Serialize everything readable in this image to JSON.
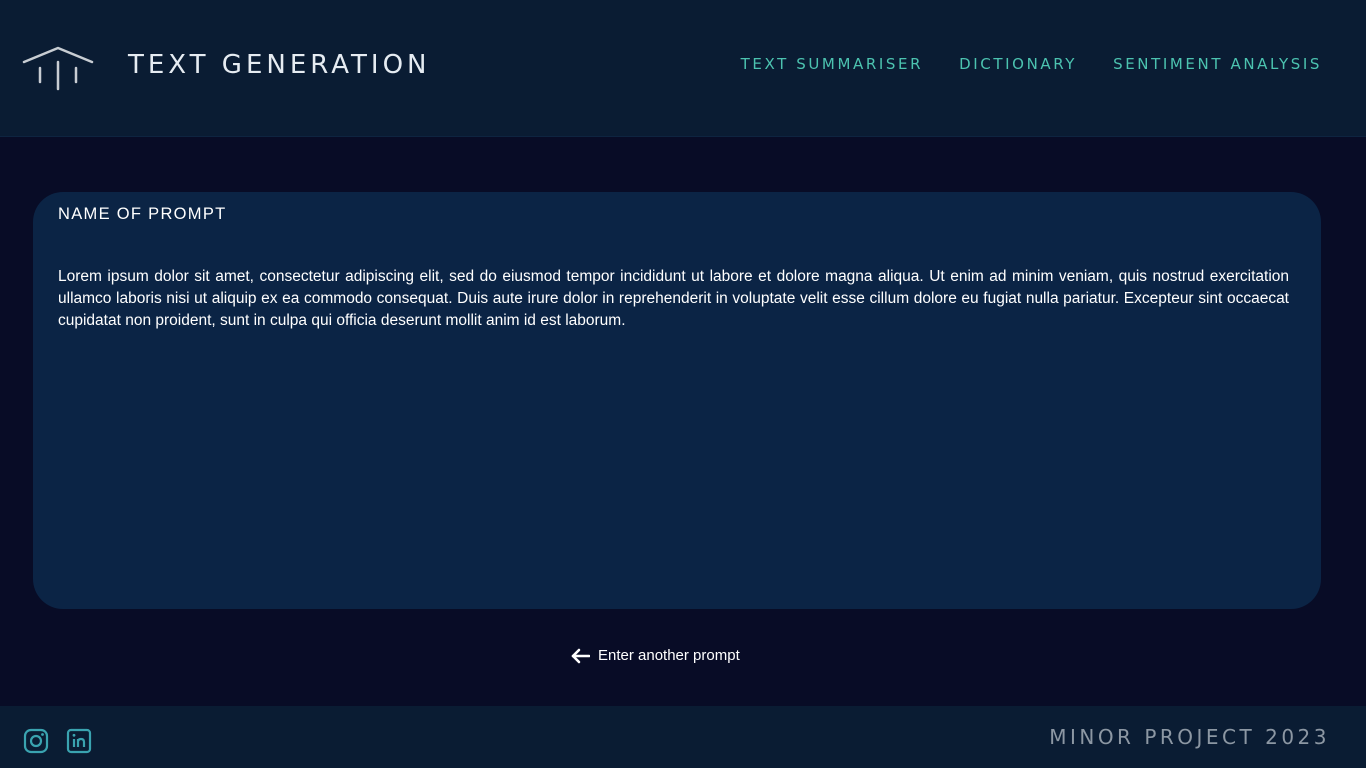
{
  "header": {
    "title": "TEXT GENERATION",
    "logo_icon": "pillars-roof-icon",
    "nav": [
      {
        "label": "TEXT SUMMARISER"
      },
      {
        "label": "DICTIONARY"
      },
      {
        "label": "SENTIMENT ANALYSIS"
      }
    ]
  },
  "card": {
    "prompt_name": "NAME OF PROMPT",
    "generated_text": "Lorem ipsum dolor sit amet, consectetur adipiscing elit, sed do eiusmod tempor incididunt ut labore et dolore magna aliqua. Ut enim ad minim veniam, quis nostrud exercitation ullamco laboris nisi ut aliquip ex ea commodo consequat. Duis aute irure dolor in reprehenderit in voluptate velit esse cillum dolore eu fugiat nulla pariatur. Excepteur sint occaecat cupidatat non proident, sunt in culpa qui officia deserunt mollit anim id est laborum."
  },
  "back_link": {
    "label": "Enter another prompt",
    "icon": "arrow-left-icon"
  },
  "footer": {
    "text": "MINOR PROJECT 2023",
    "social": [
      {
        "icon": "instagram-icon"
      },
      {
        "icon": "linkedin-icon"
      }
    ]
  },
  "colors": {
    "background": "#080c26",
    "header_bg": "#0a1c33",
    "card_bg": "#0b2445",
    "accent": "#4cc3b0",
    "footer_text": "#8c97a3"
  }
}
